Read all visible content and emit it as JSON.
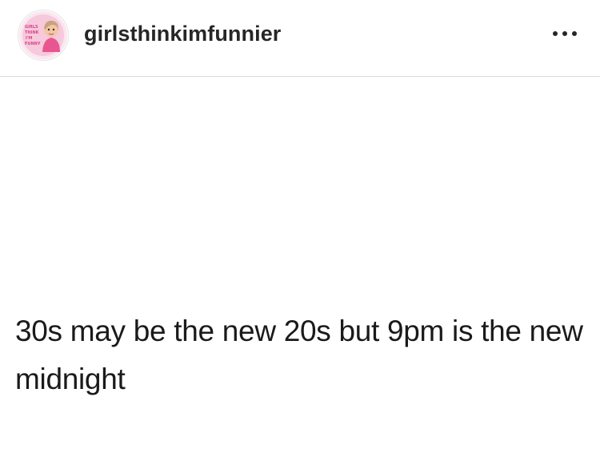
{
  "post": {
    "username": "girlsthinkimfunnier",
    "avatar_badge_lines": [
      "GIRLS",
      "THINK",
      "I'M",
      "FUNNY"
    ],
    "more_icon": "ellipsis-horizontal-icon",
    "image_text": "30s may be the new 20s but 9pm is the new midnight"
  },
  "colors": {
    "avatar_pink": "#f6c9dc",
    "avatar_text": "#d9468a",
    "divider": "#dbdbdb",
    "text": "#262626"
  }
}
